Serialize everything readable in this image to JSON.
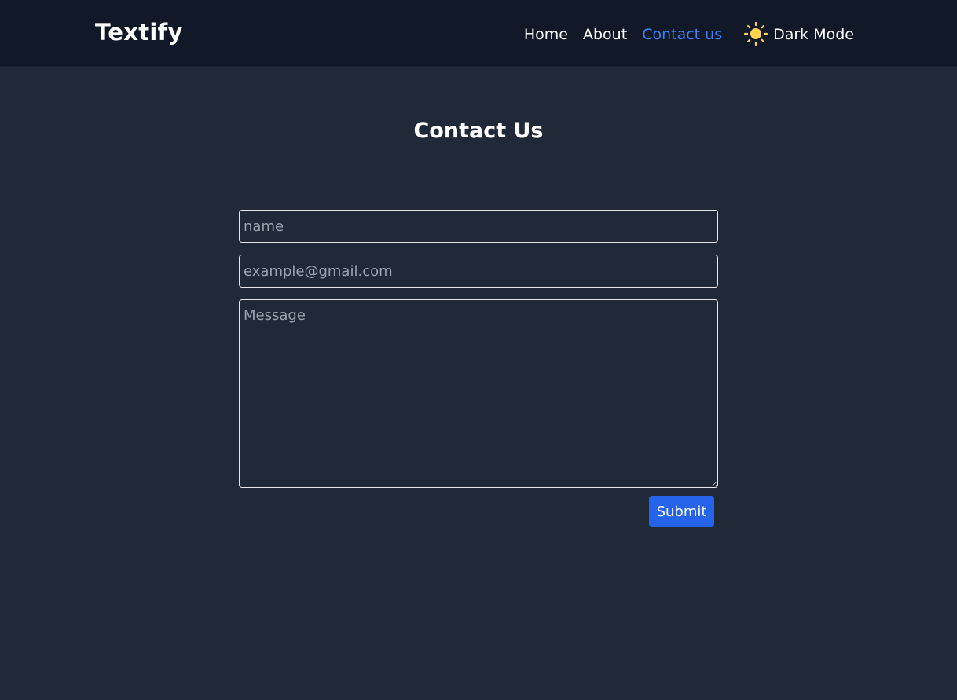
{
  "navbar": {
    "brand": "Textify",
    "links": [
      {
        "label": "Home",
        "active": false
      },
      {
        "label": "About",
        "active": false
      },
      {
        "label": "Contact us",
        "active": true
      }
    ],
    "mode_toggle": {
      "icon": "sun-icon",
      "label": "Dark Mode"
    }
  },
  "main": {
    "title": "Contact Us",
    "form": {
      "name": {
        "value": "",
        "placeholder": "name"
      },
      "email": {
        "value": "",
        "placeholder": "example@gmail.com"
      },
      "message": {
        "value": "",
        "placeholder": "Message"
      },
      "submit_label": "Submit"
    }
  },
  "colors": {
    "page_background": "#1f2937",
    "navbar_background": "#111827",
    "active_link": "#3b82f6",
    "button": "#2563eb",
    "sun": "#fcd34d"
  }
}
